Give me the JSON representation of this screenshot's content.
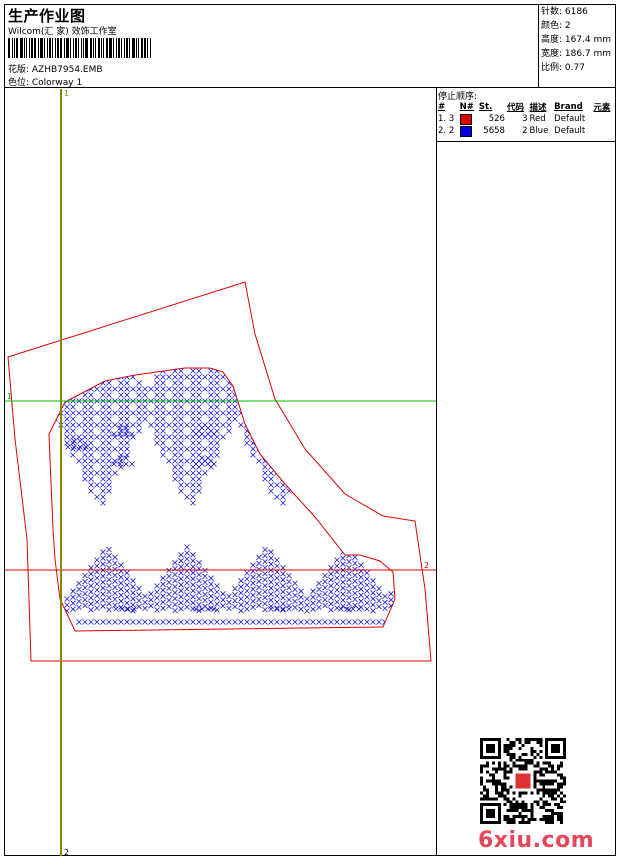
{
  "header": {
    "title": "生产作业图",
    "studio": "Wilcom(汇 家) 效饰工作室",
    "design_label": "花版: AZHB7954.EMB",
    "colorway_label": "色位: Colorway 1"
  },
  "stats": {
    "stitches": "针数: 6186",
    "colors": "颜色: 2",
    "height": "高度: 167.4 mm",
    "width": "宽度: 186.7 mm",
    "ratio": "比例: 0.77"
  },
  "stop_sequence": {
    "title": "停止顺序:",
    "headers": [
      "#",
      "N#",
      "St.",
      "代码",
      "描述",
      "Brand",
      "元素"
    ],
    "rows": [
      {
        "index": "1.",
        "n": "3",
        "color": "#e00000",
        "stitches": "526",
        "code": "3",
        "desc": "Red",
        "brand": "Default"
      },
      {
        "index": "2.",
        "n": "2",
        "color": "#0000e0",
        "stitches": "5658",
        "code": "2",
        "desc": "Blue",
        "brand": "Default"
      }
    ]
  },
  "guides": {
    "vertical_top_label": "1",
    "vertical_bottom_label": "2",
    "horizontal_left_label": "1",
    "horizontal_right_label": "2"
  },
  "colors": {
    "outline": "#e00000",
    "stitch": "#1a1ad6",
    "guide_green": "#00c000",
    "guide_olive": "#8a8a00",
    "guide_red": "#e00000"
  },
  "watermark": {
    "text": "6xiu.com"
  }
}
